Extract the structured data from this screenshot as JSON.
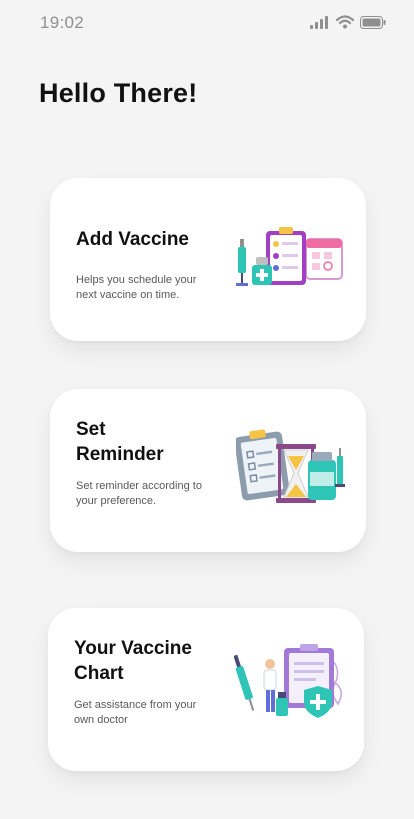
{
  "status_bar": {
    "time": "19:02",
    "icons": [
      "signal-icon",
      "wifi-icon",
      "battery-icon"
    ]
  },
  "greeting": "Hello There!",
  "cards": [
    {
      "title": "Add Vaccine",
      "description": "Helps you schedule your next vaccine on time.",
      "illustration": "clipboard-calendar-illustration"
    },
    {
      "title": "Set Reminder",
      "description": "Set reminder according to your preference.",
      "illustration": "hourglass-reminder-illustration"
    },
    {
      "title": "Your Vaccine Chart",
      "description": "Get assistance from your own doctor",
      "illustration": "doctor-chart-illustration"
    }
  ],
  "colors": {
    "background": "#f4f4f4",
    "card": "#ffffff",
    "purple": "#a33fc4",
    "teal": "#2ec4b6",
    "pink": "#f06ba2",
    "yellow": "#f5c445"
  }
}
